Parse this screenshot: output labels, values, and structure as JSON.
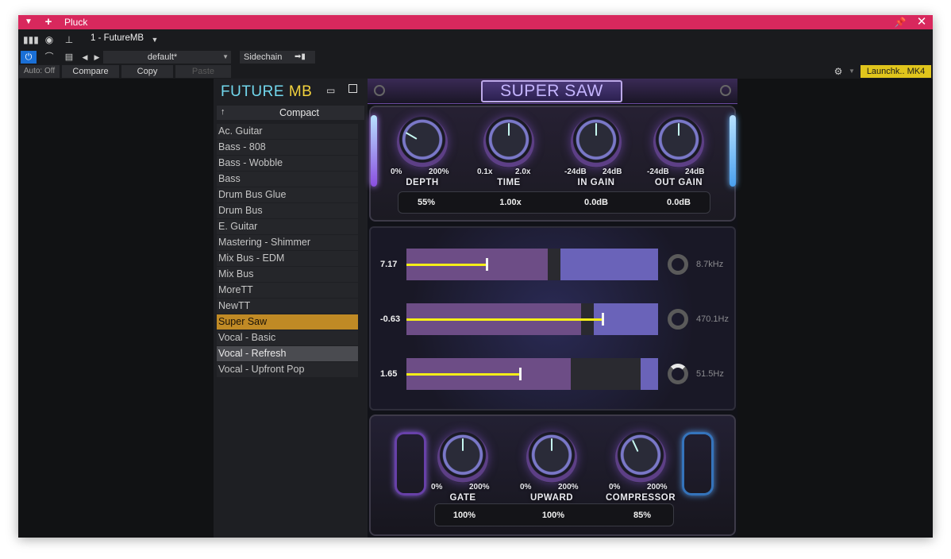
{
  "window": {
    "title": "Pluck",
    "menu_icon": "triangle-down-icon",
    "add_icon": "plus-icon",
    "pin_icon": "pin-icon",
    "close_icon": "close-icon"
  },
  "host": {
    "instance_label": "1 - FutureMB",
    "preset_name": "default*",
    "sidechain_label": "Sidechain",
    "auto_label": "Auto: Off",
    "compare_label": "Compare",
    "copy_label": "Copy",
    "paste_label": "Paste",
    "device_label": "Launchk.. MK4",
    "accent_color": "#1a6fd6",
    "device_color": "#e0c51c"
  },
  "plugin": {
    "brand_part1": "FUTURE",
    "brand_part2": "MB",
    "browser_mode": "Compact",
    "up_arrow": "↑",
    "presets": [
      {
        "label": "Ac. Guitar",
        "state": ""
      },
      {
        "label": "Bass - 808",
        "state": ""
      },
      {
        "label": "Bass - Wobble",
        "state": ""
      },
      {
        "label": "Bass",
        "state": ""
      },
      {
        "label": "Drum Bus Glue",
        "state": ""
      },
      {
        "label": "Drum Bus",
        "state": ""
      },
      {
        "label": "E. Guitar",
        "state": ""
      },
      {
        "label": "Mastering - Shimmer",
        "state": ""
      },
      {
        "label": "Mix Bus - EDM",
        "state": ""
      },
      {
        "label": "Mix Bus",
        "state": ""
      },
      {
        "label": "MoreTT",
        "state": ""
      },
      {
        "label": "NewTT",
        "state": ""
      },
      {
        "label": "Super Saw",
        "state": "selected"
      },
      {
        "label": "Vocal - Basic",
        "state": ""
      },
      {
        "label": "Vocal - Refresh",
        "state": "hover"
      },
      {
        "label": "Vocal - Upfront Pop",
        "state": ""
      }
    ],
    "preset_title": "SUPER SAW",
    "top_knobs": [
      {
        "name": "DEPTH",
        "min": "0%",
        "max": "200%",
        "value": "55%"
      },
      {
        "name": "TIME",
        "min": "0.1x",
        "max": "2.0x",
        "value": "1.00x"
      },
      {
        "name": "IN GAIN",
        "min": "-24dB",
        "max": "24dB",
        "value": "0.0dB"
      },
      {
        "name": "OUT GAIN",
        "min": "-24dB",
        "max": "24dB",
        "value": "0.0dB"
      }
    ],
    "bands": [
      {
        "value": "7.17",
        "freq": "8.7kHz",
        "level": 0.32
      },
      {
        "value": "-0.63",
        "freq": "470.1Hz",
        "level": 0.78
      },
      {
        "value": "1.65",
        "freq": "51.5Hz",
        "level": 0.45
      }
    ],
    "bottom_knobs": [
      {
        "name": "GATE",
        "min": "0%",
        "max": "200%",
        "value": "100%"
      },
      {
        "name": "UPWARD",
        "min": "0%",
        "max": "200%",
        "value": "100%"
      },
      {
        "name": "COMPRESSOR",
        "min": "0%",
        "max": "200%",
        "value": "85%"
      }
    ]
  }
}
